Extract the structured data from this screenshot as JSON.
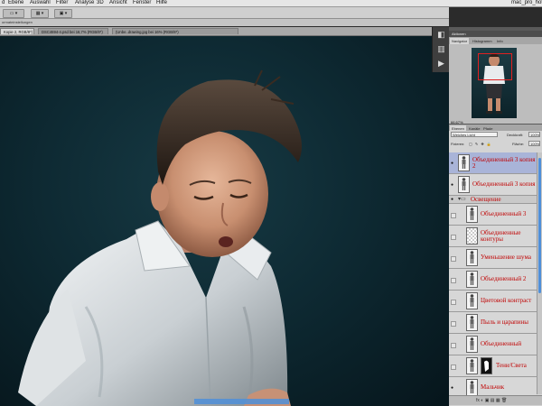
{
  "menubar": {
    "items": [
      "d",
      "Ebene",
      "Auswahl",
      "Filter",
      "Analyse",
      "3D",
      "Ansicht",
      "Fenster",
      "Hilfe"
    ],
    "right_text": "mac_pro_hot"
  },
  "options_bar": {
    "context_text": "ormateinstellungen"
  },
  "tabs": [
    {
      "label": "Kopie 2, RGB/8*)",
      "active": true
    },
    {
      "label": "DSC4694-4.psd bei 16,7% (RGB/8*)",
      "active": false
    },
    {
      "label": "(Unbe..drawing.jpg bei 16% (RGB/8*)",
      "active": false
    }
  ],
  "tool_icons": [
    "adjustments-icon",
    "layer-comps-icon",
    "actions-icon"
  ],
  "navigator": {
    "panel_title": "Aktionen",
    "tabs": [
      "Navigator",
      "Histogramm",
      "Info"
    ],
    "zoom": "66,67%"
  },
  "layers_panel": {
    "tabs": [
      "Ebenen",
      "Kanäle",
      "Pfade"
    ],
    "blend_mode": "Weiches Licht",
    "opacity_label": "Deckkraft:",
    "opacity_value": "100%",
    "lock_label": "Fixieren:",
    "fill_label": "Fläche:",
    "fill_value": "100%",
    "footer": "fx ◐ ▣ ▤ ▦ 🗑",
    "layers": [
      {
        "name": "Объединенный 3 копия 2",
        "visible": true,
        "selected": true,
        "type": "layer",
        "indent": false,
        "mask": false,
        "thumb": "figure"
      },
      {
        "name": "Объединенный 3 копия",
        "visible": true,
        "selected": false,
        "type": "layer",
        "indent": false,
        "mask": false,
        "thumb": "figure"
      },
      {
        "name": "Освещение",
        "visible": true,
        "selected": false,
        "type": "group",
        "indent": false,
        "mask": false,
        "thumb": "folder"
      },
      {
        "name": "Объединенный 3",
        "visible": false,
        "selected": false,
        "type": "layer",
        "indent": true,
        "mask": false,
        "thumb": "figure"
      },
      {
        "name": "Объединенные контуры",
        "visible": false,
        "selected": false,
        "type": "layer",
        "indent": true,
        "mask": false,
        "thumb": "checker"
      },
      {
        "name": "Уменьшение шума",
        "visible": false,
        "selected": false,
        "type": "layer",
        "indent": true,
        "mask": false,
        "thumb": "figure"
      },
      {
        "name": "Объединенный 2",
        "visible": false,
        "selected": false,
        "type": "layer",
        "indent": true,
        "mask": false,
        "thumb": "figure"
      },
      {
        "name": "Цветовой контраст",
        "visible": false,
        "selected": false,
        "type": "layer",
        "indent": true,
        "mask": false,
        "thumb": "figure"
      },
      {
        "name": "Пыль и царапины",
        "visible": false,
        "selected": false,
        "type": "layer",
        "indent": true,
        "mask": false,
        "thumb": "figure"
      },
      {
        "name": "Объединенный",
        "visible": false,
        "selected": false,
        "type": "layer",
        "indent": true,
        "mask": false,
        "thumb": "figure"
      },
      {
        "name": "Тени/Света",
        "visible": false,
        "selected": false,
        "type": "layer",
        "indent": true,
        "mask": true,
        "thumb": "figure"
      },
      {
        "name": "Мальчик",
        "visible": true,
        "selected": false,
        "type": "layer",
        "indent": true,
        "mask": false,
        "thumb": "figure"
      }
    ]
  }
}
